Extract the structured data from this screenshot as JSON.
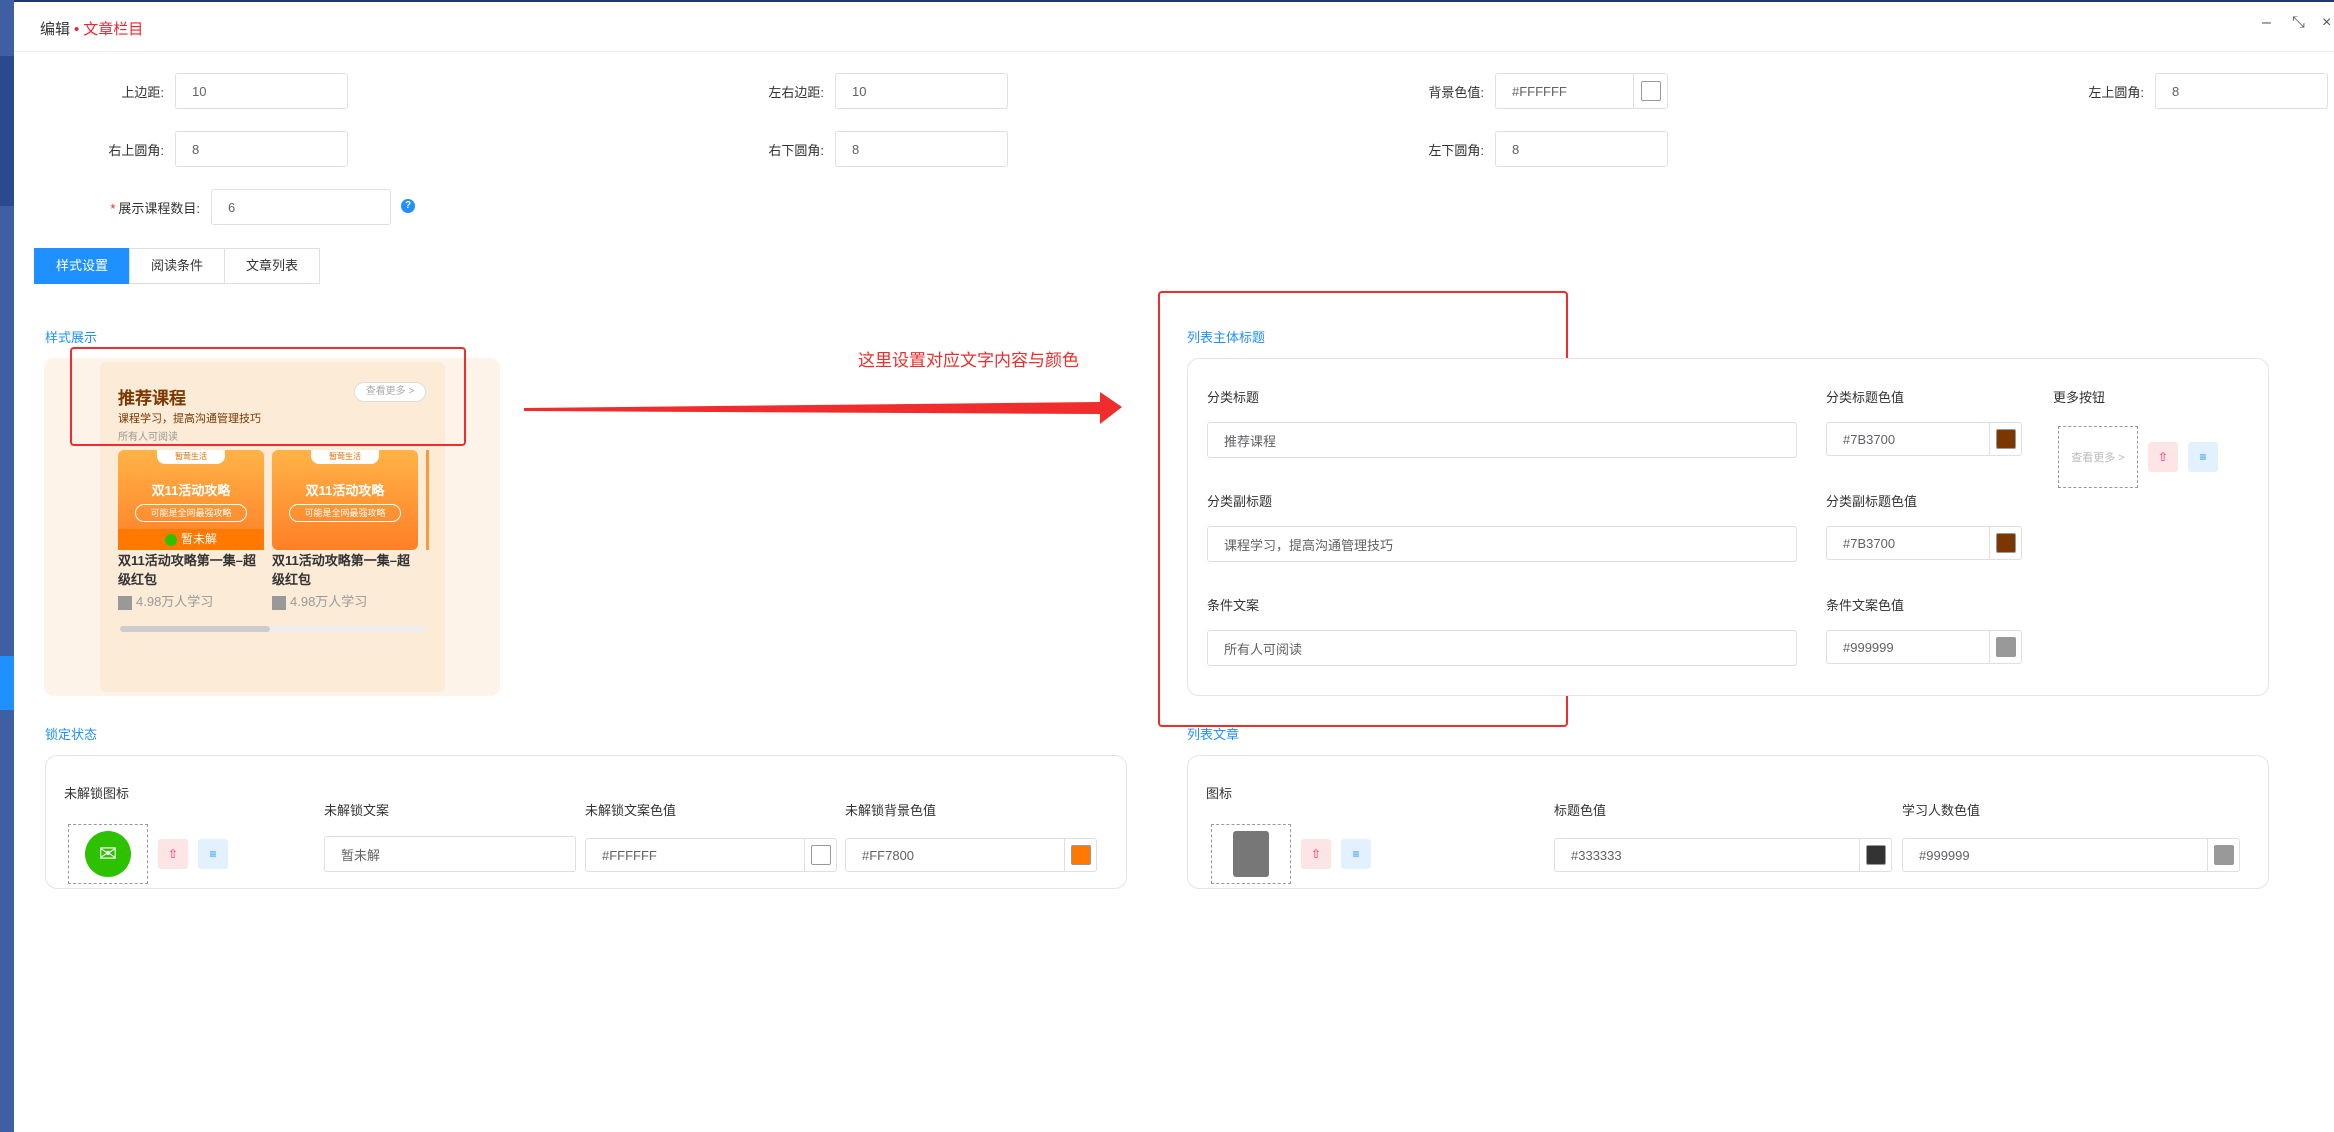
{
  "dialog": {
    "title_prefix": "编辑",
    "title_dot": "•",
    "title_name": "文章栏目",
    "minimize_glyph": "–",
    "restore_glyph": "⤡",
    "close_glyph": "×"
  },
  "form": {
    "top_margin": {
      "label": "上边距:",
      "value": "10"
    },
    "lr_margin": {
      "label": "左右边距:",
      "value": "10"
    },
    "bg_color": {
      "label": "背景色值:",
      "value": "#FFFFFF",
      "swatch": "#FFFFFF"
    },
    "tl_radius": {
      "label": "左上圆角:",
      "value": "8"
    },
    "tr_radius": {
      "label": "右上圆角:",
      "value": "8"
    },
    "br_radius": {
      "label": "右下圆角:",
      "value": "8"
    },
    "bl_radius": {
      "label": "左下圆角:",
      "value": "8"
    },
    "course_count": {
      "required": "*",
      "label": "展示课程数目:",
      "value": "6",
      "help": "?"
    }
  },
  "tabs": [
    {
      "label": "样式设置"
    },
    {
      "label": "阅读条件"
    },
    {
      "label": "文章列表"
    }
  ],
  "preview": {
    "section_title": "样式展示",
    "title": "推荐课程",
    "subtitle": "课程学习，提高沟通管理技巧",
    "condition": "所有人可阅读",
    "more": "查看更多 >",
    "items": [
      {
        "tag": "暂莺生活",
        "headline": "双11活动攻略",
        "pill": "可能是全网最强攻略",
        "lock": "暂未解",
        "name": "双11活动攻略第一集–超级红包",
        "learners": "4.98万人学习"
      },
      {
        "tag": "暂莺生活",
        "headline": "双11活动攻略",
        "pill": "可能是全网最强攻略",
        "name": "双11活动攻略第一集–超级红包",
        "learners": "4.98万人学习"
      }
    ]
  },
  "annotation": {
    "text": "这里设置对应文字内容与颜色"
  },
  "list_header": {
    "section_title": "列表主体标题",
    "cat_title_label": "分类标题",
    "cat_title_value": "推荐课程",
    "cat_title_color_label": "分类标题色值",
    "cat_title_color": "#7B3700",
    "more_button_label": "更多按钮",
    "more_button_preview": "查看更多 >",
    "cat_sub_label": "分类副标题",
    "cat_sub_value": "课程学习，提高沟通管理技巧",
    "cat_sub_color_label": "分类副标题色值",
    "cat_sub_color": "#7B3700",
    "cond_label": "条件文案",
    "cond_value": "所有人可阅读",
    "cond_color_label": "条件文案色值",
    "cond_color": "#999999"
  },
  "lock_state": {
    "section_title": "锁定状态",
    "icon_label": "未解锁图标",
    "text_label": "未解锁文案",
    "text_value": "暂未解",
    "text_color_label": "未解锁文案色值",
    "text_color": "#FFFFFF",
    "bg_color_label": "未解锁背景色值",
    "bg_color": "#FF7800"
  },
  "list_article": {
    "section_title": "列表文章",
    "icon_label": "图标",
    "title_color_label": "标题色值",
    "title_color": "#333333",
    "learners_color_label": "学习人数色值",
    "learners_color": "#999999"
  },
  "colors": {
    "accent": "#1E90FF",
    "annotation": "#F02C2C"
  }
}
